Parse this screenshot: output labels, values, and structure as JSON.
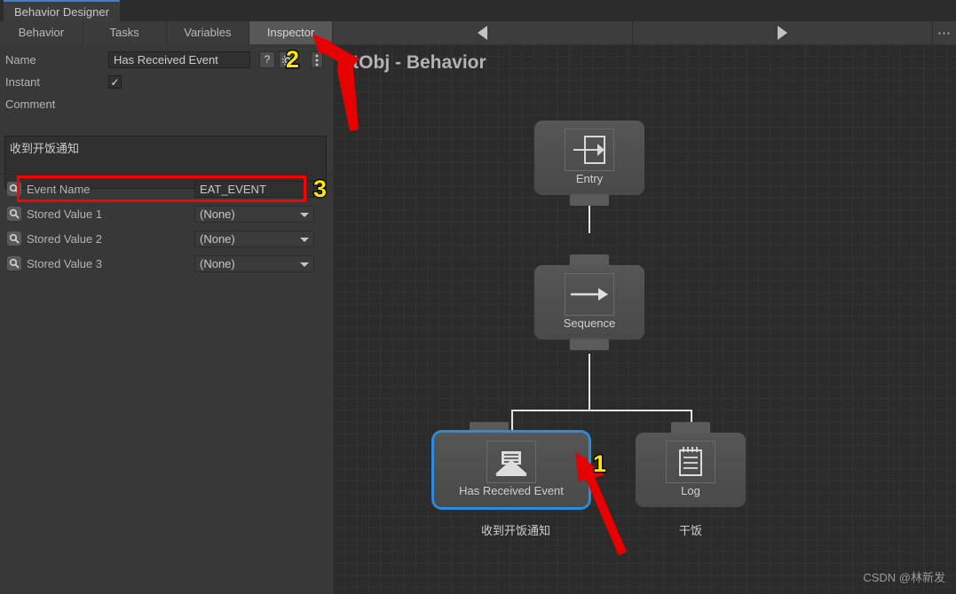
{
  "window": {
    "tab_title": "Behavior Designer"
  },
  "inspector": {
    "tabs": [
      {
        "label": "Behavior",
        "selected": false
      },
      {
        "label": "Tasks",
        "selected": false
      },
      {
        "label": "Variables",
        "selected": false
      },
      {
        "label": "Inspector",
        "selected": true
      }
    ],
    "name_label": "Name",
    "name_value": "Has Received Event",
    "help_icon": "?",
    "gear_icon": "gear-icon",
    "kebab_icon": "kebab-menu-icon",
    "instant_label": "Instant",
    "instant_checked": "✓",
    "comment_label": "Comment",
    "comment_value": "收到开饭通知",
    "variables": [
      {
        "label": "Event Name",
        "value": "EAT_EVENT",
        "is_dropdown": false
      },
      {
        "label": "Stored Value 1",
        "value": "(None)",
        "is_dropdown": true
      },
      {
        "label": "Stored Value 2",
        "value": "(None)",
        "is_dropdown": true
      },
      {
        "label": "Stored Value 3",
        "value": "(None)",
        "is_dropdown": true
      }
    ]
  },
  "graph": {
    "toolbar": {
      "back_icon": "triangle-left-icon",
      "forward_icon": "triangle-right-icon",
      "more_icon": "ellipsis-icon"
    },
    "title": "BtObj - Behavior",
    "nodes": [
      {
        "label": "Entry",
        "icon": "entry-arrow-into-box-icon",
        "comment": "",
        "selected": false
      },
      {
        "label": "Sequence",
        "icon": "right-arrow-icon",
        "comment": "",
        "selected": false
      },
      {
        "label": "Has Received Event",
        "icon": "open-envelope-icon",
        "comment": "收到开饭通知",
        "selected": true
      },
      {
        "label": "Log",
        "icon": "notepad-icon",
        "comment": "干饭",
        "selected": false
      }
    ]
  },
  "annotations": {
    "marker_1": "1",
    "marker_2": "2",
    "marker_3": "3",
    "highlight_color": "#ff0000",
    "marker_color": "#ffe500"
  },
  "watermark": "CSDN @林新发"
}
